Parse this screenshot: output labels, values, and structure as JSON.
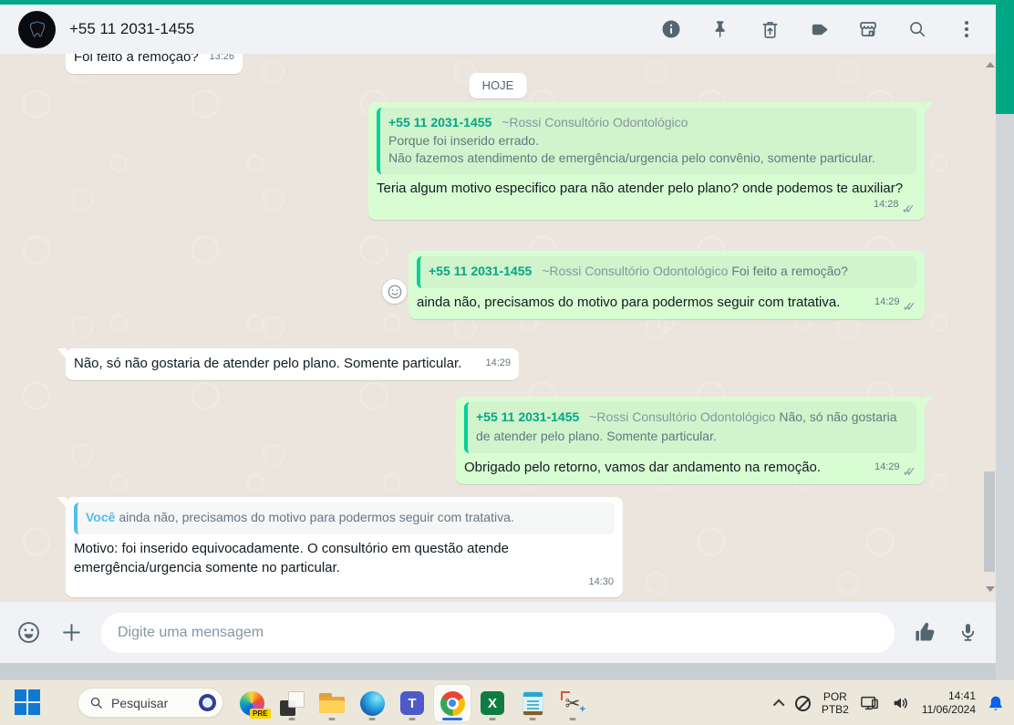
{
  "header": {
    "title": "+55 11 2031-1455",
    "action_icons": [
      "info-icon",
      "pin-icon",
      "delete-message-icon",
      "label-icon",
      "storefront-icon",
      "search-icon",
      "menu-icon"
    ]
  },
  "chat": {
    "date_divider": "HOJE",
    "sender_phone": "+55 11 2031-1455",
    "sender_name": "~Rossi Consultório Odontológico",
    "you_label": "Você",
    "clipped": {
      "text": "Foi feito a remoção?",
      "time": "13:26"
    },
    "messages": [
      {
        "direction": "out",
        "quote_line1": "Porque foi inserido errado.",
        "quote_line2": "Não fazemos atendimento de emergência/urgencia pelo convênio, somente particular.",
        "text": "Teria algum motivo especifico para não atender pelo plano? onde podemos te auxiliar?",
        "time": "14:28"
      },
      {
        "direction": "out",
        "quote": "Foi feito a remoção?",
        "text": "ainda não, precisamos do motivo para podermos seguir com tratativa.",
        "time": "14:29"
      },
      {
        "direction": "in",
        "text": "Não, só não gostaria de atender pelo plano. Somente particular.",
        "time": "14:29"
      },
      {
        "direction": "out",
        "quote": "Não, só não gostaria de atender pelo plano. Somente particular.",
        "text": "Obrigado pelo retorno, vamos dar andamento na remoção.",
        "time": "14:29"
      },
      {
        "direction": "in",
        "quote": "ainda não, precisamos do motivo para podermos seguir com tratativa.",
        "text": "Motivo: foi inserido equivocadamente. O consultório em questão atende emergência/urgencia somente no particular.",
        "time": "14:30"
      }
    ]
  },
  "composer": {
    "placeholder": "Digite uma mensagem"
  },
  "taskbar": {
    "search_placeholder": "Pesquisar",
    "copilot_badge": "PRE",
    "teams_glyph": "T",
    "excel_glyph": "X",
    "scissors_glyph": "✂",
    "plus_glyph": "+",
    "tray": {
      "lang_line1": "POR",
      "lang_line2": "PTB2",
      "time": "14:41",
      "date": "11/06/2024"
    }
  },
  "colors": {
    "accent_teal": "#00a884",
    "outgoing_bubble": "#d9fdd3",
    "incoming_bubble": "#ffffff",
    "quote_border_out": "#06cf9c",
    "quote_border_in": "#53bdeb",
    "taskbar_active_indicator": "#2a6ce0",
    "notification_bell": "#0b63e5"
  }
}
